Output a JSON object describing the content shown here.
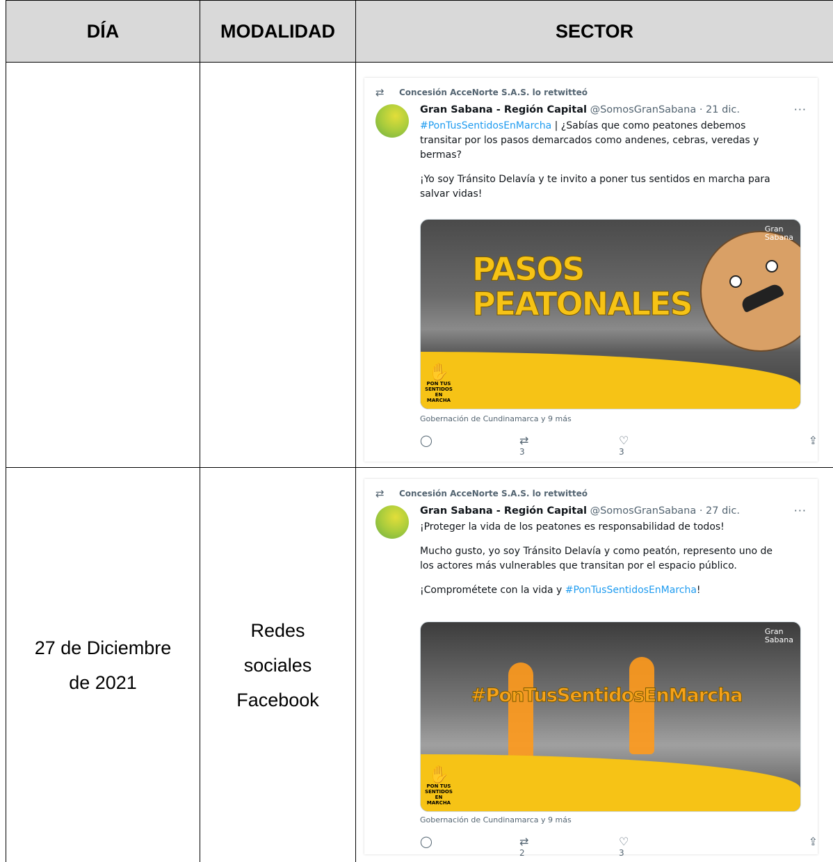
{
  "headers": {
    "dia": "DÍA",
    "modalidad": "MODALIDAD",
    "sector": "SECTOR"
  },
  "row2": {
    "dia_line1": "27 de Diciembre",
    "dia_line2": "de 2021",
    "modalidad_line1": "Redes",
    "modalidad_line2": "sociales",
    "modalidad_line3": "Facebook"
  },
  "tweet1": {
    "retweet_line": "Concesión AcceNorte S.A.S. lo retwitteó",
    "name": "Gran Sabana - Región Capital",
    "handle": "@SomosGranSabana · 21 dic.",
    "hashtag": "#PonTusSentidosEnMarcha",
    "text1_rest": " | ¿Sabías que como peatones debemos transitar por los pasos demarcados como andenes, cebras, veredas y bermas?",
    "text2": "¡Yo soy Tránsito Delavía y te invito a poner tus sentidos en marcha para salvar vidas!",
    "media_title_line1": "PASOS",
    "media_title_line2": "PEATONALES",
    "brand_line1": "Gran",
    "brand_line2": "Sabana",
    "hand_line1": "PON TUS",
    "hand_line2": "SENTIDOS",
    "hand_line3": "EN MARCHA",
    "tagged": "Gobernación de Cundinamarca y 9 más",
    "retweets": "3",
    "likes": "3"
  },
  "tweet2": {
    "retweet_line": "Concesión AcceNorte S.A.S. lo retwitteó",
    "name": "Gran Sabana - Región Capital",
    "handle": "@SomosGranSabana · 27 dic.",
    "text1": "¡Proteger la vida de los peatones es responsabilidad de todos!",
    "text2": "Mucho gusto, yo soy Tránsito Delavía y como peatón, represento uno de los actores más vulnerables que transitan por el espacio público.",
    "text3_pre": "¡Comprométete con la vida y ",
    "hashtag": "#PonTusSentidosEnMarcha",
    "text3_post": "!",
    "media_title": "#PonTusSentidosEnMarcha",
    "brand_line1": "Gran",
    "brand_line2": "Sabana",
    "hand_line1": "PON TUS",
    "hand_line2": "SENTIDOS",
    "hand_line3": "EN MARCHA",
    "tagged": "Gobernación de Cundinamarca y 9 más",
    "retweets": "2",
    "likes": "3"
  },
  "icons": {
    "retweet": "retweet-icon",
    "reply": "reply-icon",
    "like": "heart-icon",
    "share": "share-icon",
    "more": "more-icon"
  },
  "colors": {
    "header_bg": "#d9d9d9",
    "hashtag": "#1d9bf0",
    "secondary_text": "#536471",
    "brand_yellow": "#f6c316"
  }
}
